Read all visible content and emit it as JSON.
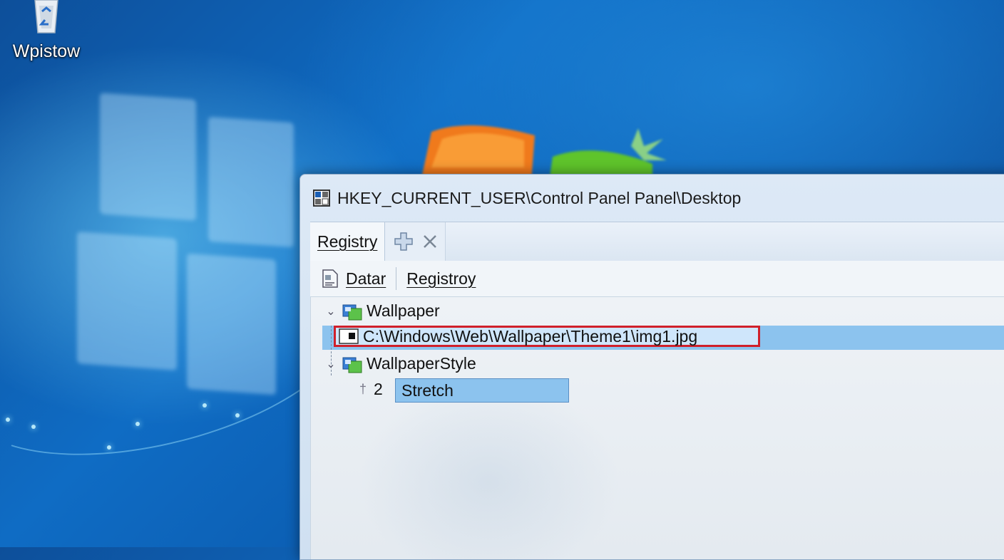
{
  "desktop": {
    "icon": {
      "name": "recycle-bin-icon",
      "label": "Wpistow"
    }
  },
  "window": {
    "title": "HKEY_CURRENT_USER\\Control Panel Panel\\Desktop",
    "title_icon": "regedit-window-icon",
    "tabs": [
      {
        "label": "Registry"
      }
    ],
    "tab_tool_icons": [
      "add-icon",
      "close-icon"
    ],
    "toolbar": {
      "items": [
        {
          "label": "Datar",
          "icon": "document-icon"
        },
        {
          "label": "Registroy"
        }
      ]
    },
    "tree": {
      "keys": [
        {
          "label": "Wallpaper",
          "value": "C:\\Windows\\Web\\Wallpaper\\Theme1\\img1.jpg"
        },
        {
          "label": "WallpaperStyle",
          "value_index": "2",
          "value": "Stretch"
        }
      ]
    }
  },
  "colors": {
    "highlight_border": "#d0202a",
    "selection": "#8cc3ee"
  }
}
